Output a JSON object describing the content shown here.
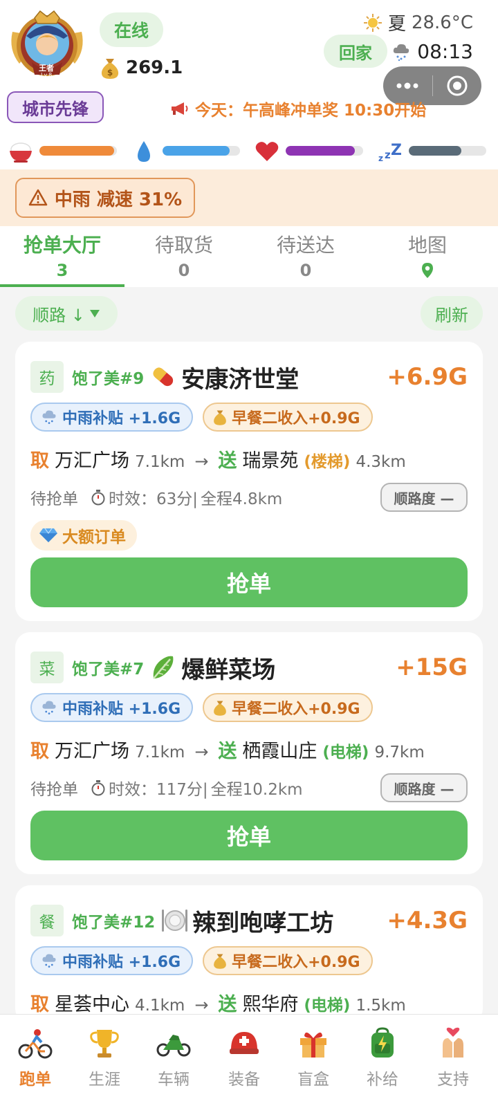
{
  "header": {
    "avatar_caption": "王者",
    "avatar_level": "Lv.8",
    "status": "在线",
    "coins": "269.1",
    "rank": "城市先锋",
    "season": "夏",
    "temperature": "28.6°C",
    "home_button": "回家",
    "time": "08:13",
    "announcement": "今天：午高峰冲单奖 10:30开始"
  },
  "stats": {
    "hunger": 0.96,
    "water": 0.87,
    "health": 0.89,
    "sleep": 0.68,
    "colors": {
      "hunger": "#ef8a3a",
      "water": "#4aa3e8",
      "health": "#8e34b3",
      "sleep": "#5a6b78"
    }
  },
  "alert": {
    "text": "中雨 减速 31%"
  },
  "tabs": [
    {
      "label": "抢单大厅",
      "count": "3"
    },
    {
      "label": "待取货",
      "count": "0"
    },
    {
      "label": "待送达",
      "count": "0"
    },
    {
      "label": "地图",
      "icon": "map-pin-icon"
    }
  ],
  "filter": {
    "sort_label": "顺路 ↓",
    "refresh": "刷新"
  },
  "orders": [
    {
      "category": "药",
      "shop": "饱了美#9",
      "shop_icon": "pill-icon",
      "store": "安康济世堂",
      "price": "+6.9G",
      "chip_rain": "中雨补贴 +1.6G",
      "chip_income": "早餐二收入+0.9G",
      "pickup_label": "取",
      "pickup": "万汇广场",
      "pickup_dist": "7.1km",
      "arrow": "→",
      "deliver_label": "送",
      "deliver": "瑞景苑",
      "lift": "(楼梯)",
      "deliver_dist": "4.3km",
      "status": "待抢单",
      "timer": "时效：63分|",
      "total": "全程4.8km",
      "route_degree": "顺路度 —",
      "big_tag": "大额订单",
      "button": "抢单"
    },
    {
      "category": "菜",
      "shop": "饱了美#7",
      "shop_icon": "lettuce-icon",
      "store": "爆鲜菜场",
      "price": "+15G",
      "chip_rain": "中雨补贴 +1.6G",
      "chip_income": "早餐二收入+0.9G",
      "pickup_label": "取",
      "pickup": "万汇广场",
      "pickup_dist": "7.1km",
      "arrow": "→",
      "deliver_label": "送",
      "deliver": "栖霞山庄",
      "lift": "(电梯)",
      "deliver_dist": "9.7km",
      "status": "待抢单",
      "timer": "时效：117分|",
      "total": "全程10.2km",
      "route_degree": "顺路度 —",
      "button": "抢单"
    },
    {
      "category": "餐",
      "shop": "饱了美#12",
      "shop_icon": "plate-icon",
      "store": "辣到咆哮工坊",
      "price": "+4.3G",
      "chip_rain": "中雨补贴 +1.6G",
      "chip_income": "早餐二收入+0.9G",
      "pickup_label": "取",
      "pickup": "星荟中心",
      "pickup_dist": "4.1km",
      "arrow": "→",
      "deliver_label": "送",
      "deliver": "熙华府",
      "lift": "(电梯)",
      "deliver_dist": "1.5km"
    }
  ],
  "tabbar": [
    {
      "label": "跑单",
      "icon": "cyclist-icon"
    },
    {
      "label": "生涯",
      "icon": "trophy-icon"
    },
    {
      "label": "车辆",
      "icon": "motorcycle-icon"
    },
    {
      "label": "装备",
      "icon": "helmet-icon"
    },
    {
      "label": "盲盒",
      "icon": "gift-icon"
    },
    {
      "label": "补给",
      "icon": "backpack-icon"
    },
    {
      "label": "支持",
      "icon": "heart-hands-icon"
    }
  ]
}
